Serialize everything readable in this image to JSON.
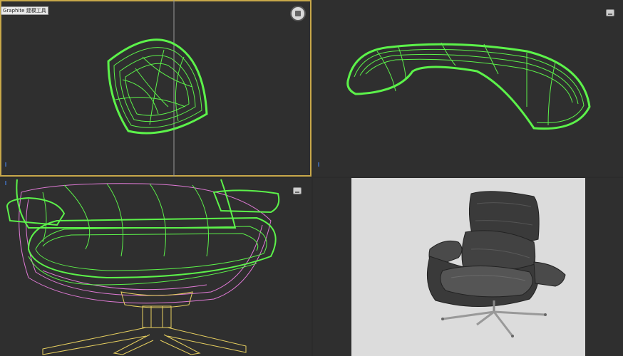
{
  "toolbar": {
    "graphite_label": "Graphite 建模工具"
  },
  "icons": {
    "viewcube_top": "viewcube-home-icon",
    "viewcube_small": "viewcube-icon",
    "axis": "axis-tripod-icon"
  },
  "colors": {
    "background": "#2f2f2f",
    "active_border": "#c8a84a",
    "wire_green": "#5cf24a",
    "wire_pink": "#e07ad6",
    "wire_yellow": "#e8d060",
    "render_bg": "#dcdcdc"
  }
}
